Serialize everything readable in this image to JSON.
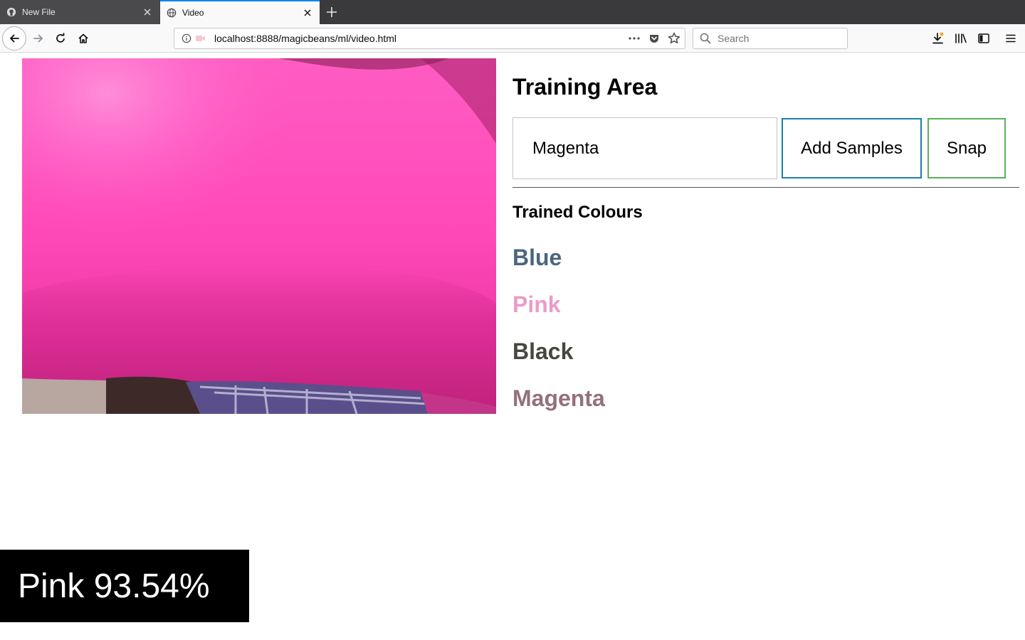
{
  "tabs": [
    {
      "title": "New File",
      "active": false
    },
    {
      "title": "Video",
      "active": true
    }
  ],
  "address_bar": {
    "url": "localhost:8888/magicbeans/ml/video.html"
  },
  "search_bar": {
    "placeholder": "Search"
  },
  "training": {
    "title": "Training Area",
    "label_input_value": "Magenta",
    "add_samples_label": "Add Samples",
    "snap_label": "Snap",
    "trained_title": "Trained Colours",
    "colours": [
      {
        "name": "Blue",
        "color": "#4a6582"
      },
      {
        "name": "Pink",
        "color": "#e99ccd"
      },
      {
        "name": "Black",
        "color": "#474740"
      },
      {
        "name": "Magenta",
        "color": "#93707e"
      }
    ]
  },
  "prediction": {
    "text": "Pink 93.54%"
  },
  "colors": {
    "add_button_border": "#1a7fa8",
    "snap_button_border": "#5ab05a",
    "video_primary": "#ff4fb8",
    "tab_accent": "#0a84ff"
  }
}
